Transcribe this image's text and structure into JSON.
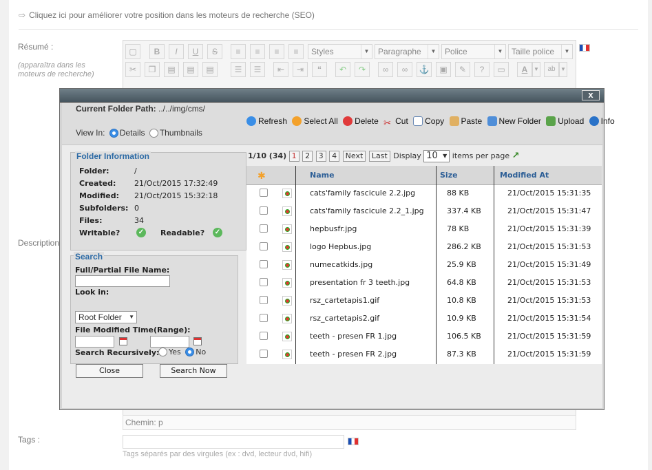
{
  "page": {
    "seo_link": "Cliquez ici pour améliorer votre position dans les moteurs de recherche (SEO)",
    "resume_label": "Résumé :",
    "resume_hint": "(apparaîtra dans les moteurs de recherche)",
    "description_label": "Description",
    "editor_toolbar": {
      "styles": "Styles",
      "paragraph": "Paragraphe",
      "font": "Police",
      "font_size": "Taille police"
    },
    "chemin": "Chemin: p",
    "tags_label": "Tags :",
    "tags_hint": "Tags séparés par des virgules (ex : dvd, lecteur dvd, hifi)"
  },
  "modal": {
    "close_label": "x",
    "current_folder_label": "Current Folder Path:",
    "current_folder_value": "../../img/cms/",
    "view_in_label": "View In:",
    "view_details": "Details",
    "view_thumbnails": "Thumbnails",
    "actions": {
      "refresh": "Refresh",
      "select_all": "Select All",
      "delete": "Delete",
      "cut": "Cut",
      "copy": "Copy",
      "paste": "Paste",
      "new_folder": "New Folder",
      "upload": "Upload",
      "info": "Info"
    },
    "folder_info": {
      "legend": "Folder Information",
      "folder_label": "Folder:",
      "folder_value": "/",
      "created_label": "Created:",
      "created_value": "21/Oct/2015 17:32:49",
      "modified_label": "Modified:",
      "modified_value": "21/Oct/2015 15:32:18",
      "subfolders_label": "Subfolders:",
      "subfolders_value": "0",
      "files_label": "Files:",
      "files_value": "34",
      "writable_label": "Writable?",
      "readable_label": "Readable?"
    },
    "search": {
      "legend": "Search",
      "name_label": "Full/Partial File Name:",
      "look_in_label": "Look in:",
      "look_in_value": "Root Folder",
      "time_label": "File Modified Time(Range):",
      "recursive_label": "Search Recursively:",
      "yes": "Yes",
      "no": "No",
      "close_button": "Close",
      "search_button": "Search Now"
    },
    "pager": {
      "summary": "1/10 (34)",
      "pages": [
        "1",
        "2",
        "3",
        "4"
      ],
      "next": "Next",
      "last": "Last",
      "display_label": "Display",
      "per_page_value": "10",
      "items_per_page": "items per page"
    },
    "table": {
      "headers": {
        "name": "Name",
        "size": "Size",
        "modified": "Modified At"
      },
      "rows": [
        {
          "name": "cats'family fascicule 2.2.jpg",
          "size": "88 KB",
          "modified": "21/Oct/2015 15:31:35"
        },
        {
          "name": "cats'family fascicule 2.2_1.jpg",
          "size": "337.4 KB",
          "modified": "21/Oct/2015 15:31:47"
        },
        {
          "name": "hepbusfr.jpg",
          "size": "78 KB",
          "modified": "21/Oct/2015 15:31:39"
        },
        {
          "name": "logo Hepbus.jpg",
          "size": "286.2 KB",
          "modified": "21/Oct/2015 15:31:53"
        },
        {
          "name": "numecatkids.jpg",
          "size": "25.9 KB",
          "modified": "21/Oct/2015 15:31:49"
        },
        {
          "name": "presentation fr 3 teeth.jpg",
          "size": "64.8 KB",
          "modified": "21/Oct/2015 15:31:53"
        },
        {
          "name": "rsz_cartetapis1.gif",
          "size": "10.8 KB",
          "modified": "21/Oct/2015 15:31:53"
        },
        {
          "name": "rsz_cartetapis2.gif",
          "size": "10.9 KB",
          "modified": "21/Oct/2015 15:31:54"
        },
        {
          "name": "teeth - presen FR 1.jpg",
          "size": "106.5 KB",
          "modified": "21/Oct/2015 15:31:59"
        },
        {
          "name": "teeth - presen FR 2.jpg",
          "size": "87.3 KB",
          "modified": "21/Oct/2015 15:31:59"
        }
      ]
    }
  }
}
